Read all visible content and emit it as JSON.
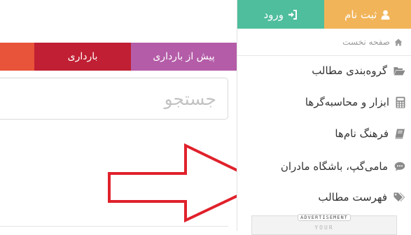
{
  "tabs": [
    {
      "label": ""
    },
    {
      "label": "بارداری"
    },
    {
      "label": "پیش از بارداری"
    }
  ],
  "search": {
    "placeholder": "جستجو",
    "value": ""
  },
  "auth": {
    "login_label": "ورود",
    "signup_label": "ثبت نام"
  },
  "breadcrumb": {
    "home": "صفحه نخست"
  },
  "sidebar": {
    "items": [
      {
        "label": "گروه‌بندی مطالب",
        "icon": "folder-open-icon"
      },
      {
        "label": "ابزار و محاسبه‌گرها",
        "icon": "calculator-icon"
      },
      {
        "label": "فرهنگ نام‌ها",
        "icon": "book-icon"
      },
      {
        "label": "مامی‌گپ، باشگاه مادران",
        "icon": "comment-icon"
      },
      {
        "label": "فهرست مطالب",
        "icon": "tags-icon"
      }
    ]
  },
  "ad": {
    "tag": "ADVERTISEMENT",
    "text": "YOUR"
  },
  "colors": {
    "tab_orange": "#e8543a",
    "tab_red": "#c11f33",
    "tab_purple": "#b45ca8",
    "login_green": "#4fbe9d",
    "signup_orange": "#f2b459",
    "arrow_red": "#e0212b"
  }
}
